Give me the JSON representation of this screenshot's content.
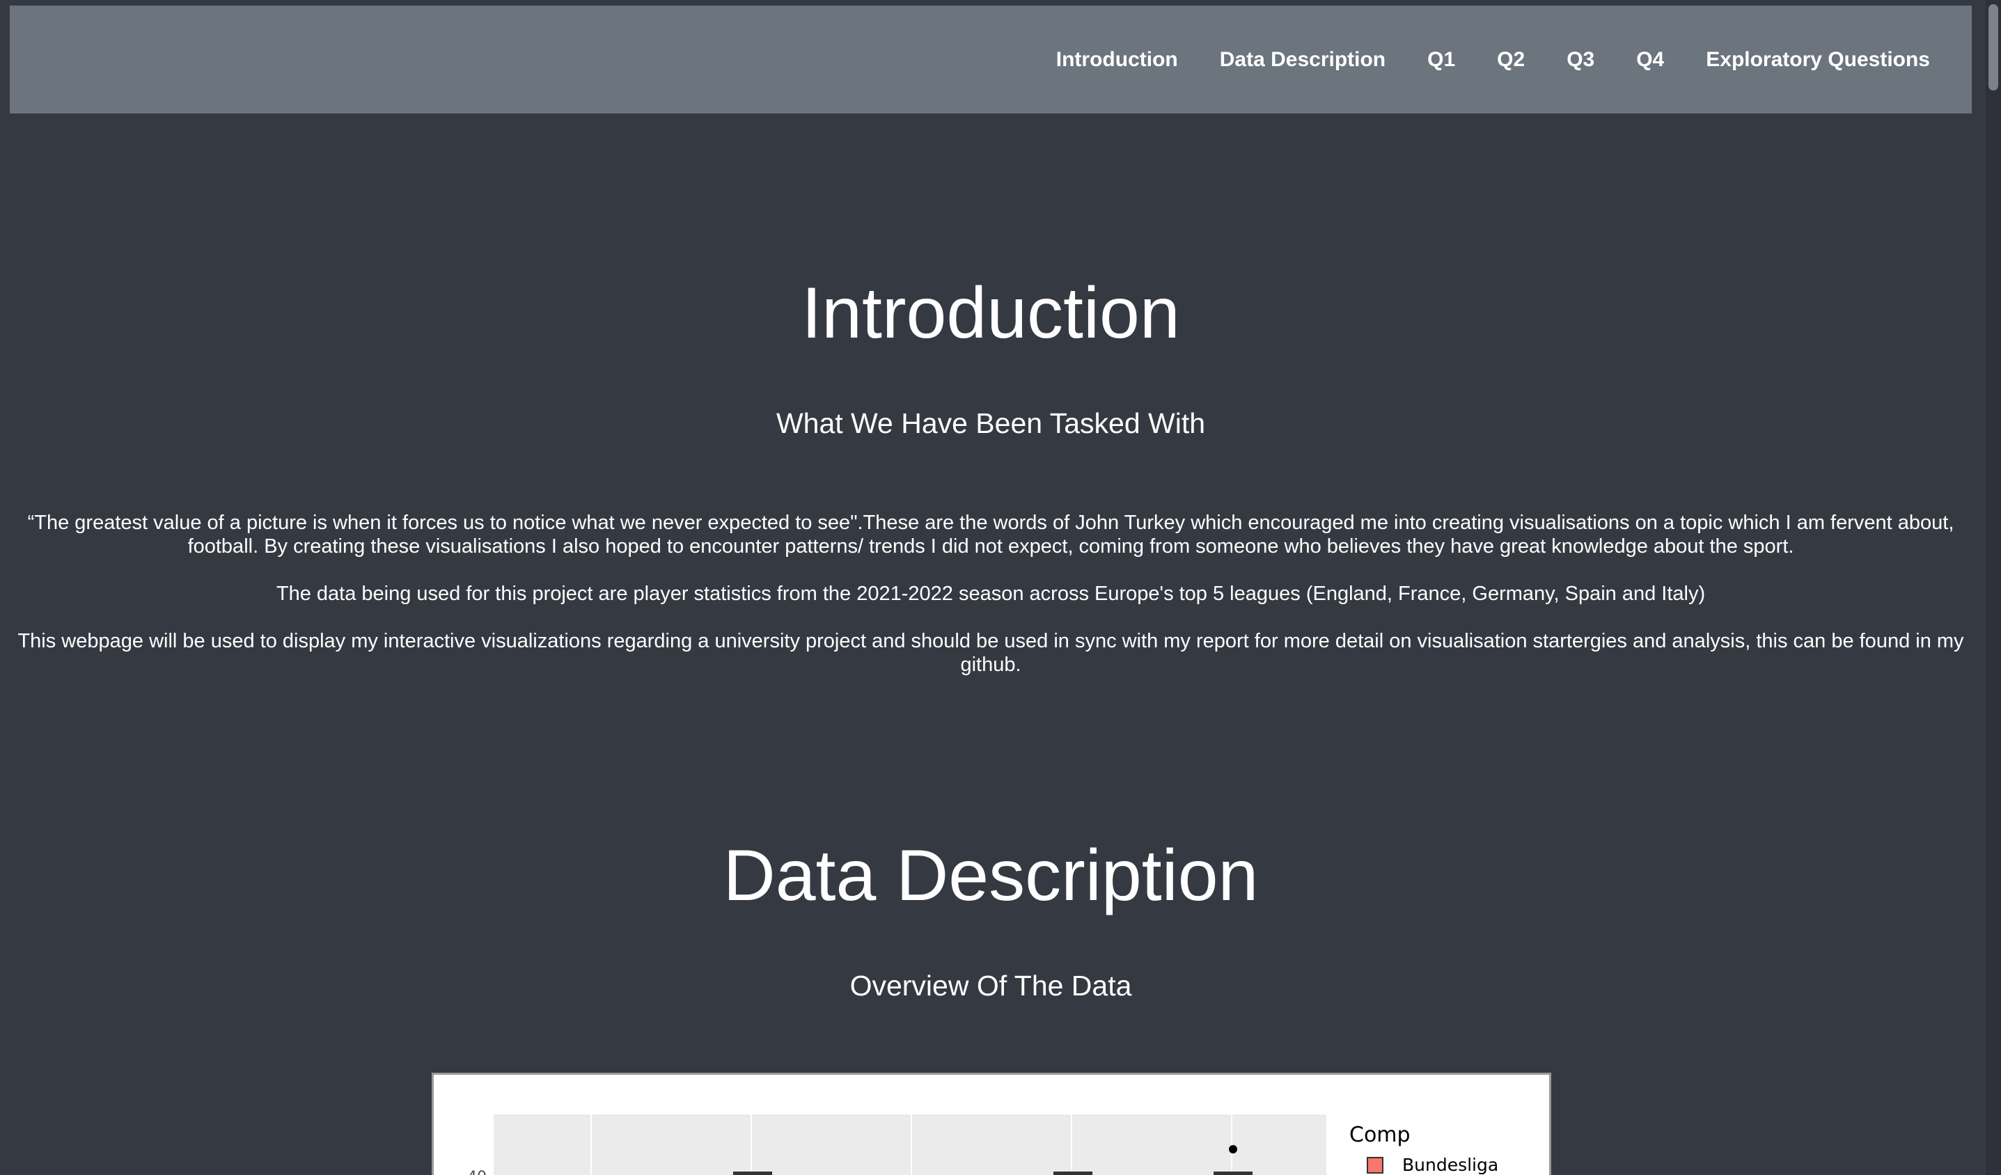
{
  "nav": {
    "items": [
      {
        "label": "Introduction"
      },
      {
        "label": "Data Description"
      },
      {
        "label": "Q1"
      },
      {
        "label": "Q2"
      },
      {
        "label": "Q3"
      },
      {
        "label": "Q4"
      },
      {
        "label": "Exploratory Questions"
      }
    ]
  },
  "intro": {
    "title": "Introduction",
    "subtitle": "What We Have Been Tasked With",
    "paragraphs": [
      "“The greatest value of a picture is when it forces us to notice what we never expected to see\".These are the words of John Turkey which encouraged me into creating visualisations on a topic which I am fervent about, football. By creating these visualisations I also hoped to encounter patterns/ trends I did not expect, coming from someone who believes they have great knowledge about the sport.",
      "The data being used for this project are player statistics from the 2021-2022 season across Europe's top 5 leagues (England, France, Germany, Spain and Italy)",
      "This webpage will be used to display my interactive visualizations regarding a university project and should be used in sync with my report for more detail on visualisation startergies and analysis, this can be found in my github."
    ]
  },
  "data_description": {
    "title": "Data Description",
    "subtitle": "Overview Of The Data"
  },
  "chart": {
    "legend_title": "Comp",
    "legend_items": [
      {
        "label": "Bundesliga",
        "color": "#f8766d"
      }
    ],
    "y_tick_visible": "40"
  },
  "colors": {
    "background": "#353a42",
    "navbar": "#6c747e",
    "panel_bg": "#ebebeb"
  }
}
